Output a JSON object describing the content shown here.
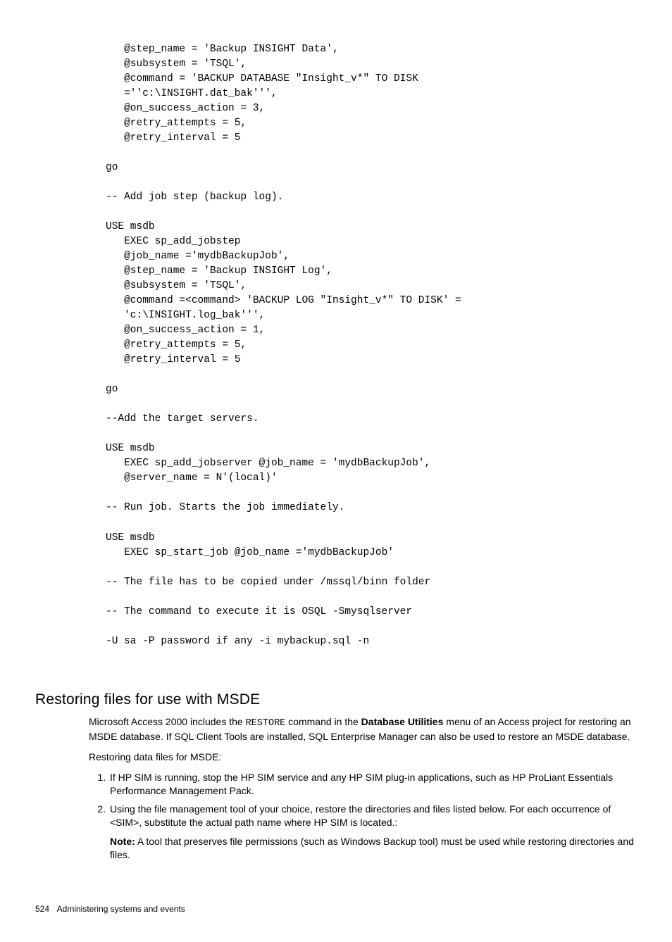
{
  "code": "   @step_name = 'Backup INSIGHT Data',\n   @subsystem = 'TSQL',\n   @command = 'BACKUP DATABASE \"Insight_v*\" TO DISK\n   =''c:\\INSIGHT.dat_bak''',\n   @on_success_action = 3,\n   @retry_attempts = 5,\n   @retry_interval = 5\n\ngo\n\n-- Add job step (backup log).\n\nUSE msdb\n   EXEC sp_add_jobstep\n   @job_name ='mydbBackupJob',\n   @step_name = 'Backup INSIGHT Log',\n   @subsystem = 'TSQL',\n   @command =<command> 'BACKUP LOG \"Insight_v*\" TO DISK' =\n   'c:\\INSIGHT.log_bak''',\n   @on_success_action = 1,\n   @retry_attempts = 5,\n   @retry_interval = 5\n\ngo\n\n--Add the target servers.\n\nUSE msdb\n   EXEC sp_add_jobserver @job_name = 'mydbBackupJob',\n   @server_name = N'(local)'\n\n-- Run job. Starts the job immediately.\n\nUSE msdb\n   EXEC sp_start_job @job_name ='mydbBackupJob'\n\n-- The file has to be copied under /mssql/binn folder\n\n-- The command to execute it is OSQL -Smysqlserver\n\n-U sa -P password if any -i mybackup.sql -n",
  "section_heading": "Restoring files for use with MSDE",
  "para1_a": "Microsoft Access 2000 includes the ",
  "para1_code": "RESTORE",
  "para1_b": " command in the ",
  "para1_bold": "Database Utilities",
  "para1_c": " menu of an Access project for restoring an MSDE database. If SQL Client Tools are installed, SQL Enterprise Manager can also be used to restore an MSDE database.",
  "para2": "Restoring data files for MSDE:",
  "steps": {
    "s1": "If HP SIM is running, stop the HP SIM service and any HP SIM plug-in applications, such as HP ProLiant Essentials Performance Management Pack.",
    "s2": "Using the file management tool of your choice, restore the directories and files listed below. For each occurrence of <SIM>, substitute the actual path name where HP SIM is located.:",
    "s2_note_b": "Note:",
    "s2_note": " A tool that preserves file permissions (such as Windows Backup tool) must be used while restoring directories and files."
  },
  "footer_page": "524",
  "footer_text": "Administering systems and events"
}
